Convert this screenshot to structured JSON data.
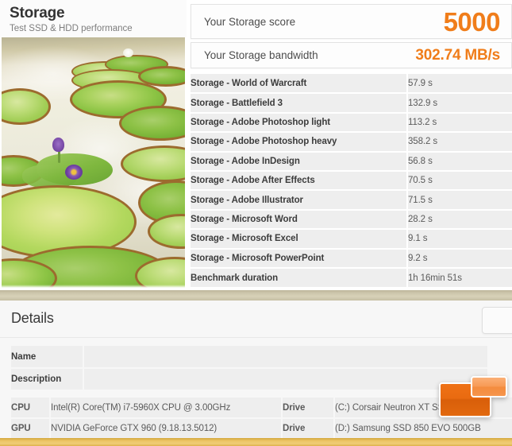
{
  "scene": {
    "title": "Storage",
    "subtitle": "Test SSD & HDD performance",
    "image_alt": "giant-water-lily-pads-pond"
  },
  "results": {
    "score_label": "Your Storage score",
    "score_value": "5000",
    "bandwidth_label": "Your Storage bandwidth",
    "bandwidth_value": "302.74 MB/s",
    "accent_color": "#f07d1a",
    "rows": [
      {
        "name": "Storage - World of Warcraft",
        "value": "57.9 s"
      },
      {
        "name": "Storage - Battlefield 3",
        "value": "132.9 s"
      },
      {
        "name": "Storage - Adobe Photoshop light",
        "value": "113.2 s"
      },
      {
        "name": "Storage - Adobe Photoshop heavy",
        "value": "358.2 s"
      },
      {
        "name": "Storage - Adobe InDesign",
        "value": "56.8 s"
      },
      {
        "name": "Storage - Adobe After Effects",
        "value": "70.5 s"
      },
      {
        "name": "Storage - Adobe Illustrator",
        "value": "71.5 s"
      },
      {
        "name": "Storage - Microsoft Word",
        "value": "28.2 s"
      },
      {
        "name": "Storage - Microsoft Excel",
        "value": "9.1 s"
      },
      {
        "name": "Storage - Microsoft PowerPoint",
        "value": "9.2 s"
      },
      {
        "name": "Benchmark duration",
        "value": "1h 16min 51s"
      }
    ]
  },
  "details": {
    "title": "Details",
    "meta": [
      {
        "label": "Name",
        "value": ""
      },
      {
        "label": "Description",
        "value": ""
      }
    ],
    "system": [
      {
        "key": "CPU",
        "value": "Intel(R) Core(TM) i7-5960X CPU @ 3.00GHz",
        "key2": "Drive",
        "value2": "(C:) Corsair Neutron XT SSD"
      },
      {
        "key": "GPU",
        "value": "NVIDIA GeForce GTX 960 (9.18.13.5012)",
        "key2": "Drive",
        "value2": "(D:) Samsung SSD 850 EVO 500GB"
      }
    ]
  },
  "logo": {
    "name": "futuremark-logo-watermark",
    "primary_color": "#ef7216",
    "secondary_color": "#f79a55"
  }
}
